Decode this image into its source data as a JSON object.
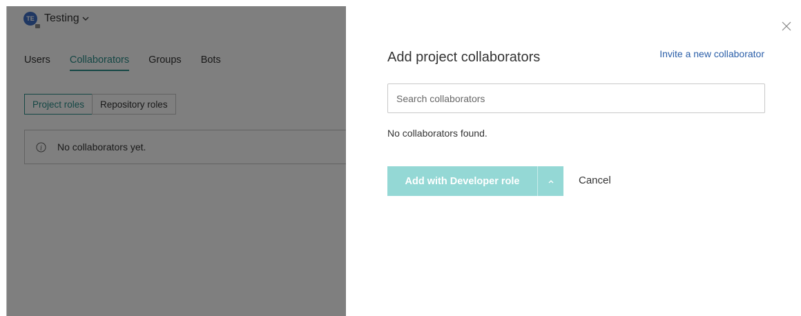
{
  "project": {
    "avatar_initials": "TE",
    "name": "Testing",
    "icon": "chevron-down-icon"
  },
  "tabs": [
    {
      "label": "Users",
      "active": false
    },
    {
      "label": "Collaborators",
      "active": true
    },
    {
      "label": "Groups",
      "active": false
    },
    {
      "label": "Bots",
      "active": false
    }
  ],
  "role_toggle": [
    {
      "label": "Project roles",
      "active": true
    },
    {
      "label": "Repository roles",
      "active": false
    }
  ],
  "empty_state": {
    "icon": "info-icon",
    "text": "No collaborators yet."
  },
  "panel": {
    "title": "Add project collaborators",
    "invite_link": "Invite a new collaborator",
    "search": {
      "placeholder": "Search collaborators",
      "value": ""
    },
    "no_results": "No collaborators found.",
    "add_button": "Add with Developer role",
    "cancel_button": "Cancel"
  },
  "colors": {
    "accent": "#2a8f8a",
    "link": "#2a5ea8",
    "primary_disabled": "#94d8d5",
    "avatar": "#3f6fc4"
  }
}
